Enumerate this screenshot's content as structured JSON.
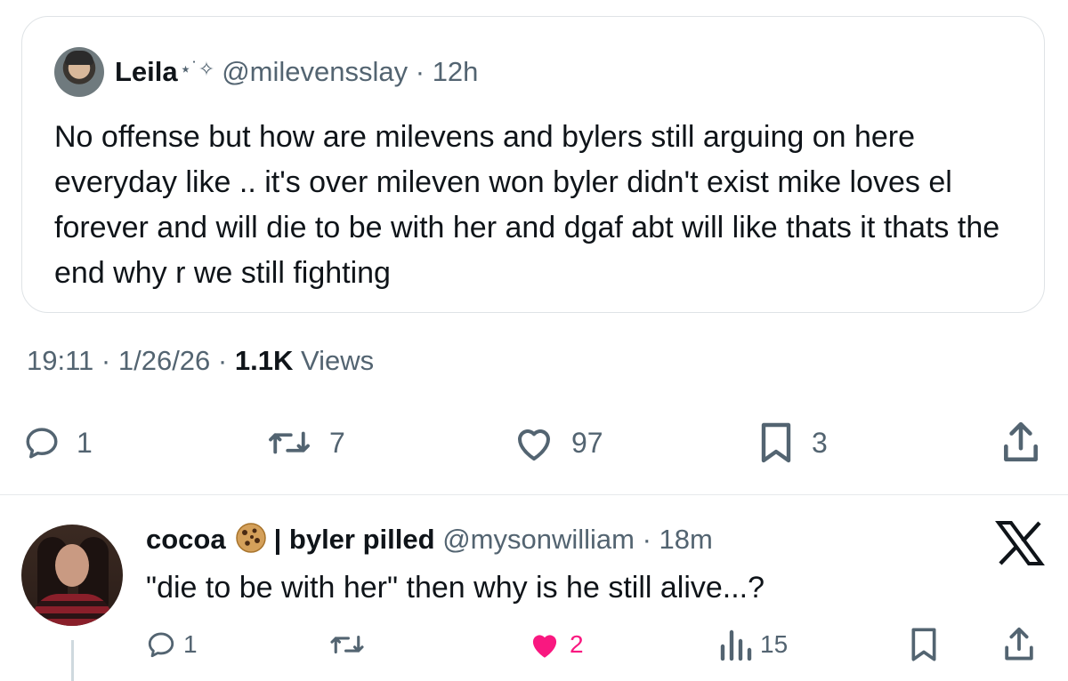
{
  "quoted_tweet": {
    "display_name": "Leila",
    "name_decoration": "⋆˙✧",
    "handle": "@milevensslay",
    "separator": "·",
    "time": "12h",
    "text": "No offense but how are milevens and bylers still arguing on here everyday like .. it's over mileven won byler didn't exist mike loves el forever and will die to be with her  and dgaf abt will like thats it thats the end why r we still fighting"
  },
  "tweet_meta": {
    "time": "19:11",
    "sep1": "·",
    "date": "1/26/26",
    "sep2": "·",
    "views_count": "1.1K",
    "views_label": "Views"
  },
  "actions": {
    "replies": "1",
    "reposts": "7",
    "likes": "97",
    "bookmarks": "3"
  },
  "reply": {
    "display_name": "cocoa",
    "name_suffix": "| byler pilled",
    "handle": "@mysonwilliam",
    "separator": "·",
    "time": "18m",
    "text": "\"die to be with her\" then why is he still alive...?",
    "replies": "1",
    "likes": "2",
    "views": "15"
  },
  "colors": {
    "text": "#0f1419",
    "muted": "#536471",
    "like_active": "#f91880",
    "border": "#dfe3e6"
  },
  "icons": [
    "reply-icon",
    "repost-icon",
    "like-icon",
    "bookmark-icon",
    "share-icon",
    "views-icon",
    "cookie-emoji-icon",
    "x-logo-icon"
  ]
}
